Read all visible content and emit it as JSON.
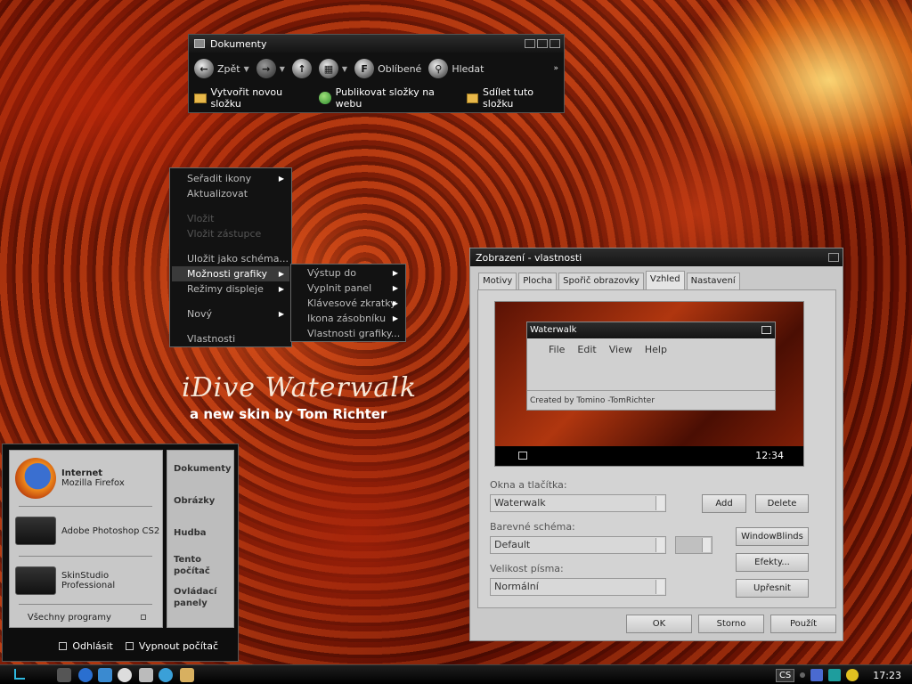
{
  "explorer": {
    "title": "Dokumenty",
    "back_label": "Zpět",
    "favorites_label": "Oblíbené",
    "search_label": "Hledat",
    "tasks": [
      "Vytvořit novou složku",
      "Publikovat složky na webu",
      "Sdílet tuto složku"
    ]
  },
  "context_menu": {
    "items": [
      "Seřadit ikony",
      "Aktualizovat",
      "Vložit",
      "Vložit zástupce",
      "Uložit jako schéma...",
      "Možnosti grafiky",
      "Režimy displeje",
      "Nový",
      "Vlastnosti"
    ],
    "submenu": [
      "Výstup do",
      "Vyplnit panel",
      "Klávesové zkratky",
      "Ikona zásobníku",
      "Vlastnosti grafiky..."
    ]
  },
  "branding": {
    "title": "iDive Waterwalk",
    "subtitle": "a new skin by Tom Richter"
  },
  "start_menu": {
    "programs": [
      {
        "name": "Internet",
        "sub": "Mozilla Firefox"
      },
      {
        "name": "Adobe Photoshop CS2",
        "sub": ""
      },
      {
        "name": "SkinStudio",
        "sub": "Professional"
      }
    ],
    "all_programs": "Všechny programy",
    "right_items": [
      "Dokumenty",
      "Obrázky",
      "Hudba",
      "Tento počítač",
      "Ovládací panely"
    ],
    "logoff": "Odhlásit",
    "shutdown": "Vypnout počítač"
  },
  "dialog": {
    "title": "Zobrazení - vlastnosti",
    "tabs": [
      "Motivy",
      "Plocha",
      "Spořič obrazovky",
      "Vzhled",
      "Nastavení"
    ],
    "active_tab": "Vzhled",
    "preview": {
      "window_title": "Waterwalk",
      "menu": [
        "File",
        "Edit",
        "View",
        "Help"
      ],
      "footer": "Created by Tomino -TomRichter",
      "clock": "12:34"
    },
    "windows_label": "Okna a tlačítka:",
    "windows_value": "Waterwalk",
    "scheme_label": "Barevné schéma:",
    "scheme_value": "Default",
    "font_label": "Velikost písma:",
    "font_value": "Normální",
    "add": "Add",
    "delete": "Delete",
    "windowblinds": "WindowBlinds",
    "effects": "Efekty...",
    "advanced": "Upřesnit",
    "ok": "OK",
    "cancel": "Storno",
    "apply": "Použít"
  },
  "taskbar": {
    "tray_lang": "CS",
    "clock": "17:23"
  }
}
